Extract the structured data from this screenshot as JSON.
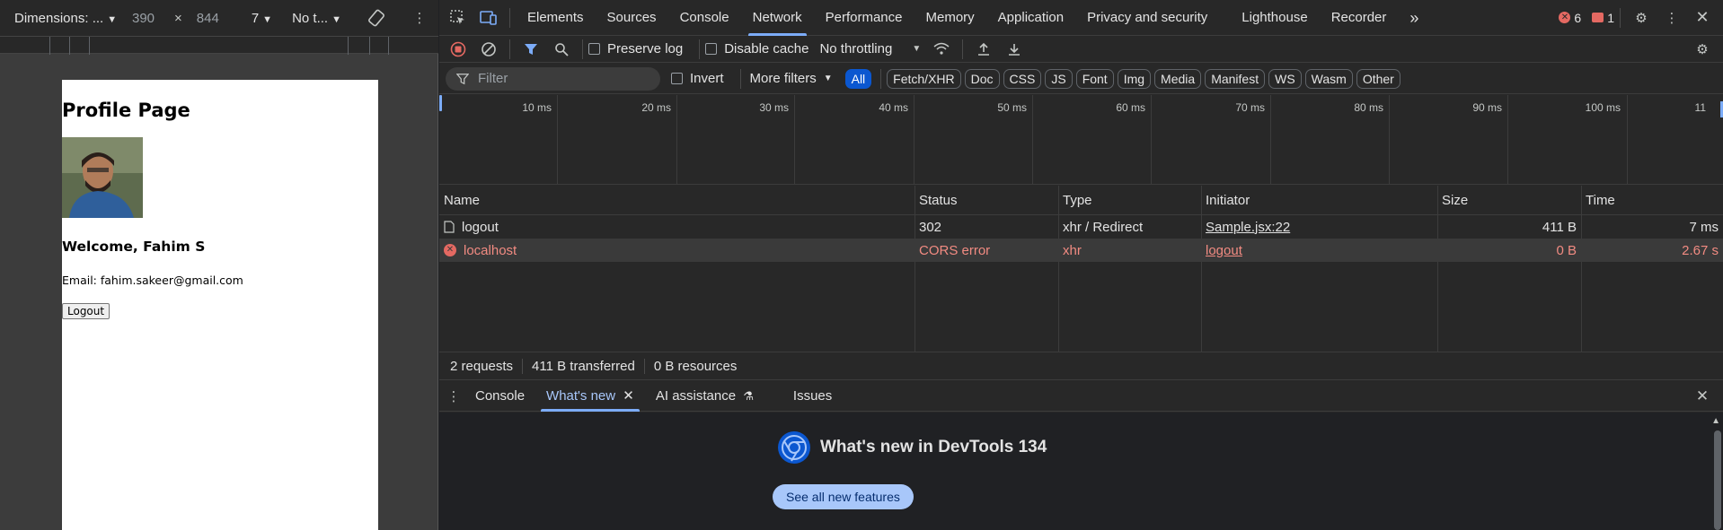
{
  "device_toolbar": {
    "dimensions_label": "Dimensions: ...",
    "width": "390",
    "times": "×",
    "height": "844",
    "zoom": "7",
    "throttle": "No t..."
  },
  "page": {
    "title": "Profile Page",
    "welcome": "Welcome, Fahim S",
    "email": "Email: fahim.sakeer@gmail.com",
    "logout_button": "Logout"
  },
  "devtools": {
    "tabs": [
      "Elements",
      "Sources",
      "Console",
      "Network",
      "Performance",
      "Memory",
      "Application",
      "Privacy and security",
      "Lighthouse",
      "Recorder"
    ],
    "active_tab": "Network",
    "more_tabs": "»",
    "errors_count": "6",
    "warnings_count": "1",
    "toolbar": {
      "preserve_log": "Preserve log",
      "disable_cache": "Disable cache",
      "throttling": "No throttling"
    },
    "filter": {
      "placeholder": "Filter",
      "invert": "Invert",
      "more_filters": "More filters",
      "types": [
        "All",
        "Fetch/XHR",
        "Doc",
        "CSS",
        "JS",
        "Font",
        "Img",
        "Media",
        "Manifest",
        "WS",
        "Wasm",
        "Other"
      ]
    },
    "timeline_ticks": [
      "10 ms",
      "20 ms",
      "30 ms",
      "40 ms",
      "50 ms",
      "60 ms",
      "70 ms",
      "80 ms",
      "90 ms",
      "100 ms",
      "11"
    ],
    "table": {
      "headers": [
        "Name",
        "Status",
        "Type",
        "Initiator",
        "Size",
        "Time"
      ],
      "rows": [
        {
          "name": "logout",
          "status": "302",
          "type": "xhr / Redirect",
          "initiator": "Sample.jsx:22",
          "size": "411 B",
          "time": "7 ms",
          "error": false
        },
        {
          "name": "localhost",
          "status": "CORS error",
          "type": "xhr",
          "initiator": "logout",
          "size": "0 B",
          "time": "2.67 s",
          "error": true
        }
      ]
    },
    "summary": {
      "requests": "2 requests",
      "transferred": "411 B transferred",
      "resources": "0 B resources"
    },
    "drawer": {
      "tabs": [
        "Console",
        "What's new",
        "AI assistance",
        "Issues"
      ],
      "active": "What's new",
      "whats_new_title": "What's new in DevTools 134",
      "see_all": "See all new features"
    }
  }
}
